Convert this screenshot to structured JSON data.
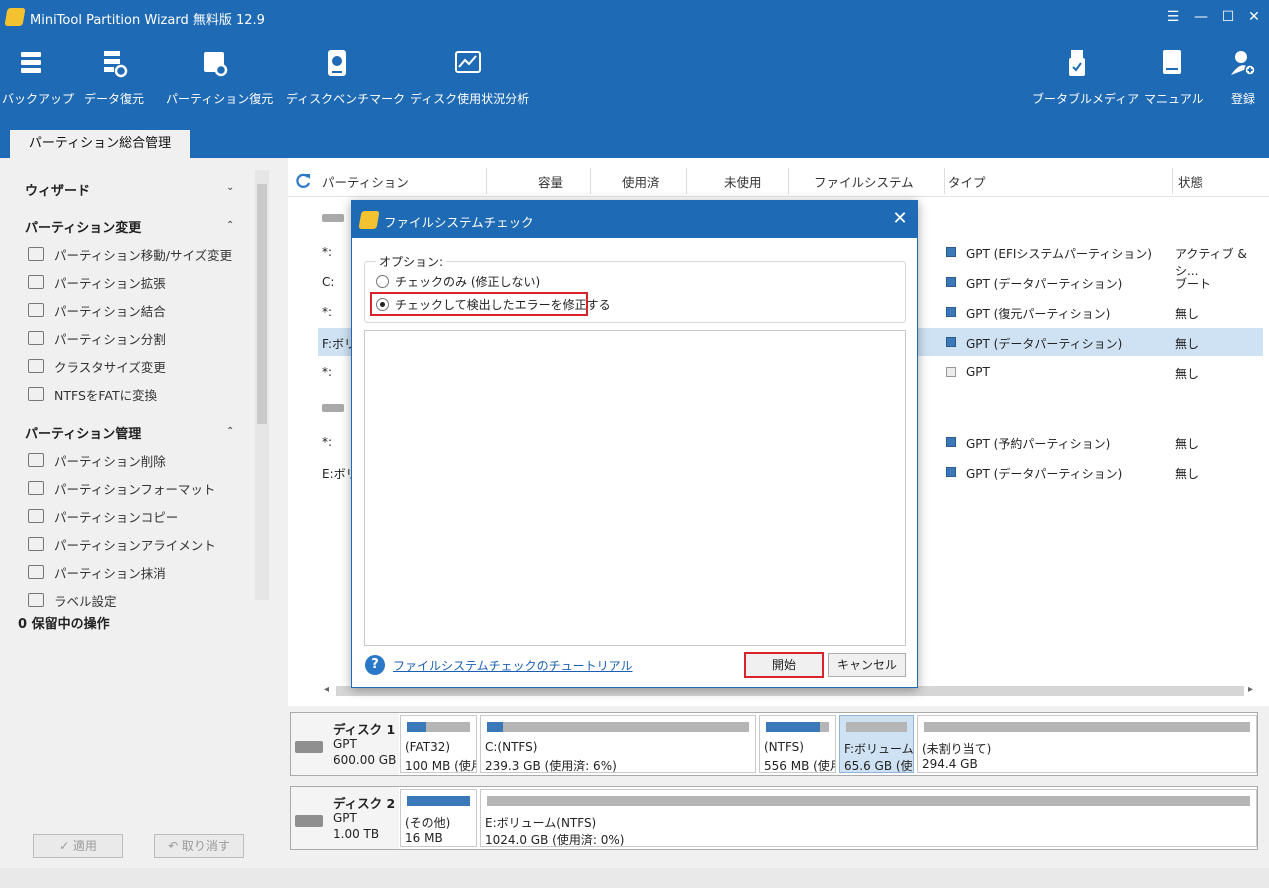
{
  "window": {
    "title": "MiniTool Partition Wizard 無料版 12.9",
    "buttons": [
      "☰",
      "—",
      "☐",
      "✕"
    ]
  },
  "toolbar": {
    "left": [
      {
        "label": "バックアップ",
        "icon": "backup-icon"
      },
      {
        "label": "データ復元",
        "icon": "data-recovery-icon"
      },
      {
        "label": "パーティション復元",
        "icon": "partition-recovery-icon"
      },
      {
        "label": "ディスクベンチマーク",
        "icon": "disk-benchmark-icon"
      },
      {
        "label": "ディスク使用状況分析",
        "icon": "space-analyzer-icon"
      }
    ],
    "right": [
      {
        "label": "ブータブルメディア",
        "icon": "bootable-media-icon"
      },
      {
        "label": "マニュアル",
        "icon": "manual-icon"
      },
      {
        "label": "登録",
        "icon": "register-icon"
      }
    ]
  },
  "tab": {
    "label": "パーティション総合管理"
  },
  "sidebar": {
    "wizard": "ウィザード",
    "change": {
      "title": "パーティション変更",
      "items": [
        "パーティション移動/サイズ変更",
        "パーティション拡張",
        "パーティション結合",
        "パーティション分割",
        "クラスタサイズ変更",
        "NTFSをFATに変換"
      ]
    },
    "manage": {
      "title": "パーティション管理",
      "items": [
        "パーティション削除",
        "パーティションフォーマット",
        "パーティションコピー",
        "パーティションアライメント",
        "パーティション抹消",
        "ラベル設定"
      ]
    },
    "pending": "0 保留中の操作",
    "apply": "✓ 適用",
    "undo": "↶ 取り消す"
  },
  "table": {
    "columns": [
      "パーティション",
      "容量",
      "使用済",
      "未使用",
      "ファイルシステム",
      "タイプ",
      "状態"
    ],
    "rows": [
      {
        "partition": "*:",
        "type": "GPT (EFIシステムパーティション)",
        "status": "アクティブ & シ..."
      },
      {
        "partition": "C:",
        "type": "GPT (データパーティション)",
        "status": "ブート"
      },
      {
        "partition": "*:",
        "type": "GPT (復元パーティション)",
        "status": "無し"
      },
      {
        "partition": "F:ボリ",
        "type": "GPT (データパーティション)",
        "status": "無し"
      },
      {
        "partition": "*:",
        "type": "GPT",
        "status": "無し"
      },
      {
        "partition": "*:",
        "type": "GPT (予約パーティション)",
        "status": "無し"
      },
      {
        "partition": "E:ボリ",
        "type": "GPT (データパーティション)",
        "status": "無し"
      }
    ]
  },
  "disks": [
    {
      "name": "ディスク 1",
      "type": "GPT",
      "size": "600.00 GB",
      "partitions": [
        {
          "l1": "(FAT32)",
          "l2": "100 MB (使月",
          "used": 0.3
        },
        {
          "l1": "C:(NTFS)",
          "l2": "239.3 GB (使用済: 6%)",
          "used": 0.06
        },
        {
          "l1": "(NTFS)",
          "l2": "556 MB (使月",
          "used": 0.85
        },
        {
          "l1": "F:ボリューム(I",
          "l2": "65.6 GB (使",
          "used": 0.0
        },
        {
          "l1": "(未割り当て)",
          "l2": "294.4 GB",
          "used": 0.0
        }
      ]
    },
    {
      "name": "ディスク 2",
      "type": "GPT",
      "size": "1.00 TB",
      "partitions": [
        {
          "l1": "(その他)",
          "l2": "16 MB",
          "used": 1.0
        },
        {
          "l1": "E:ボリューム(NTFS)",
          "l2": "1024.0 GB (使用済: 0%)",
          "used": 0.0
        }
      ]
    }
  ],
  "dialog": {
    "title": "ファイルシステムチェック",
    "options_legend": "オプション:",
    "option1": "チェックのみ (修正しない)",
    "option2": "チェックして検出したエラーを修正する",
    "help_link": "ファイルシステムチェックのチュートリアル",
    "start": "開始",
    "cancel": "キャンセル"
  }
}
